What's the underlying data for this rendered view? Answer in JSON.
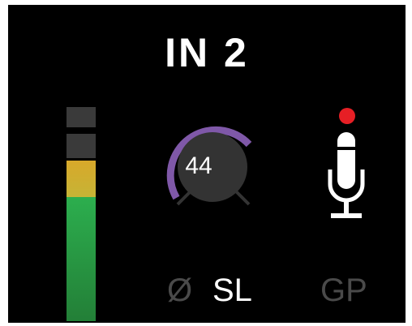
{
  "channel": {
    "name": "IN 2"
  },
  "meter": {
    "segments": [
      "off",
      "off",
      "yellow",
      "green"
    ]
  },
  "gain": {
    "value": "44",
    "ring_color": "#7f58a8"
  },
  "mic": {
    "icon": "microphone-icon",
    "indicator_color": "#e61f25"
  },
  "labels": {
    "phase": "Ø",
    "stereo_link": "SL",
    "group": "GP"
  },
  "colors": {
    "meter_green": "#2cae4e",
    "meter_yellow": "#d8a82a",
    "inactive": "#4a4a4a"
  }
}
